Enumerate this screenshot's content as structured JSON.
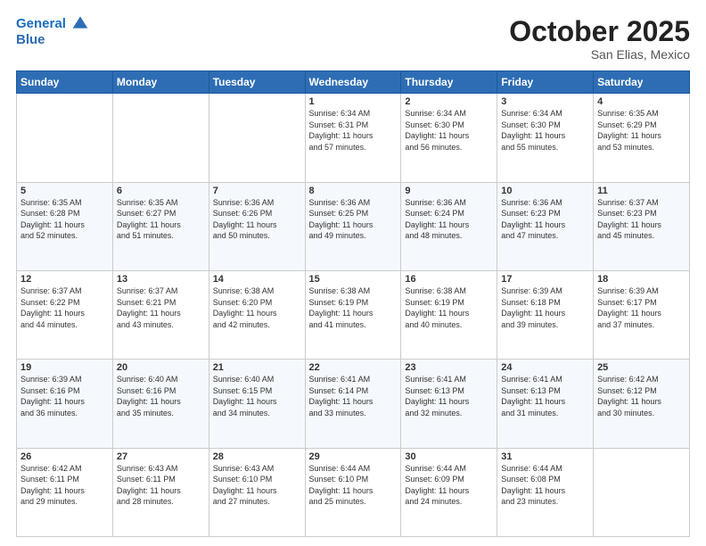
{
  "header": {
    "logo_line1": "General",
    "logo_line2": "Blue",
    "month": "October 2025",
    "location": "San Elias, Mexico"
  },
  "days_of_week": [
    "Sunday",
    "Monday",
    "Tuesday",
    "Wednesday",
    "Thursday",
    "Friday",
    "Saturday"
  ],
  "weeks": [
    [
      {
        "num": "",
        "info": ""
      },
      {
        "num": "",
        "info": ""
      },
      {
        "num": "",
        "info": ""
      },
      {
        "num": "1",
        "info": "Sunrise: 6:34 AM\nSunset: 6:31 PM\nDaylight: 11 hours\nand 57 minutes."
      },
      {
        "num": "2",
        "info": "Sunrise: 6:34 AM\nSunset: 6:30 PM\nDaylight: 11 hours\nand 56 minutes."
      },
      {
        "num": "3",
        "info": "Sunrise: 6:34 AM\nSunset: 6:30 PM\nDaylight: 11 hours\nand 55 minutes."
      },
      {
        "num": "4",
        "info": "Sunrise: 6:35 AM\nSunset: 6:29 PM\nDaylight: 11 hours\nand 53 minutes."
      }
    ],
    [
      {
        "num": "5",
        "info": "Sunrise: 6:35 AM\nSunset: 6:28 PM\nDaylight: 11 hours\nand 52 minutes."
      },
      {
        "num": "6",
        "info": "Sunrise: 6:35 AM\nSunset: 6:27 PM\nDaylight: 11 hours\nand 51 minutes."
      },
      {
        "num": "7",
        "info": "Sunrise: 6:36 AM\nSunset: 6:26 PM\nDaylight: 11 hours\nand 50 minutes."
      },
      {
        "num": "8",
        "info": "Sunrise: 6:36 AM\nSunset: 6:25 PM\nDaylight: 11 hours\nand 49 minutes."
      },
      {
        "num": "9",
        "info": "Sunrise: 6:36 AM\nSunset: 6:24 PM\nDaylight: 11 hours\nand 48 minutes."
      },
      {
        "num": "10",
        "info": "Sunrise: 6:36 AM\nSunset: 6:23 PM\nDaylight: 11 hours\nand 47 minutes."
      },
      {
        "num": "11",
        "info": "Sunrise: 6:37 AM\nSunset: 6:23 PM\nDaylight: 11 hours\nand 45 minutes."
      }
    ],
    [
      {
        "num": "12",
        "info": "Sunrise: 6:37 AM\nSunset: 6:22 PM\nDaylight: 11 hours\nand 44 minutes."
      },
      {
        "num": "13",
        "info": "Sunrise: 6:37 AM\nSunset: 6:21 PM\nDaylight: 11 hours\nand 43 minutes."
      },
      {
        "num": "14",
        "info": "Sunrise: 6:38 AM\nSunset: 6:20 PM\nDaylight: 11 hours\nand 42 minutes."
      },
      {
        "num": "15",
        "info": "Sunrise: 6:38 AM\nSunset: 6:19 PM\nDaylight: 11 hours\nand 41 minutes."
      },
      {
        "num": "16",
        "info": "Sunrise: 6:38 AM\nSunset: 6:19 PM\nDaylight: 11 hours\nand 40 minutes."
      },
      {
        "num": "17",
        "info": "Sunrise: 6:39 AM\nSunset: 6:18 PM\nDaylight: 11 hours\nand 39 minutes."
      },
      {
        "num": "18",
        "info": "Sunrise: 6:39 AM\nSunset: 6:17 PM\nDaylight: 11 hours\nand 37 minutes."
      }
    ],
    [
      {
        "num": "19",
        "info": "Sunrise: 6:39 AM\nSunset: 6:16 PM\nDaylight: 11 hours\nand 36 minutes."
      },
      {
        "num": "20",
        "info": "Sunrise: 6:40 AM\nSunset: 6:16 PM\nDaylight: 11 hours\nand 35 minutes."
      },
      {
        "num": "21",
        "info": "Sunrise: 6:40 AM\nSunset: 6:15 PM\nDaylight: 11 hours\nand 34 minutes."
      },
      {
        "num": "22",
        "info": "Sunrise: 6:41 AM\nSunset: 6:14 PM\nDaylight: 11 hours\nand 33 minutes."
      },
      {
        "num": "23",
        "info": "Sunrise: 6:41 AM\nSunset: 6:13 PM\nDaylight: 11 hours\nand 32 minutes."
      },
      {
        "num": "24",
        "info": "Sunrise: 6:41 AM\nSunset: 6:13 PM\nDaylight: 11 hours\nand 31 minutes."
      },
      {
        "num": "25",
        "info": "Sunrise: 6:42 AM\nSunset: 6:12 PM\nDaylight: 11 hours\nand 30 minutes."
      }
    ],
    [
      {
        "num": "26",
        "info": "Sunrise: 6:42 AM\nSunset: 6:11 PM\nDaylight: 11 hours\nand 29 minutes."
      },
      {
        "num": "27",
        "info": "Sunrise: 6:43 AM\nSunset: 6:11 PM\nDaylight: 11 hours\nand 28 minutes."
      },
      {
        "num": "28",
        "info": "Sunrise: 6:43 AM\nSunset: 6:10 PM\nDaylight: 11 hours\nand 27 minutes."
      },
      {
        "num": "29",
        "info": "Sunrise: 6:44 AM\nSunset: 6:10 PM\nDaylight: 11 hours\nand 25 minutes."
      },
      {
        "num": "30",
        "info": "Sunrise: 6:44 AM\nSunset: 6:09 PM\nDaylight: 11 hours\nand 24 minutes."
      },
      {
        "num": "31",
        "info": "Sunrise: 6:44 AM\nSunset: 6:08 PM\nDaylight: 11 hours\nand 23 minutes."
      },
      {
        "num": "",
        "info": ""
      }
    ]
  ]
}
